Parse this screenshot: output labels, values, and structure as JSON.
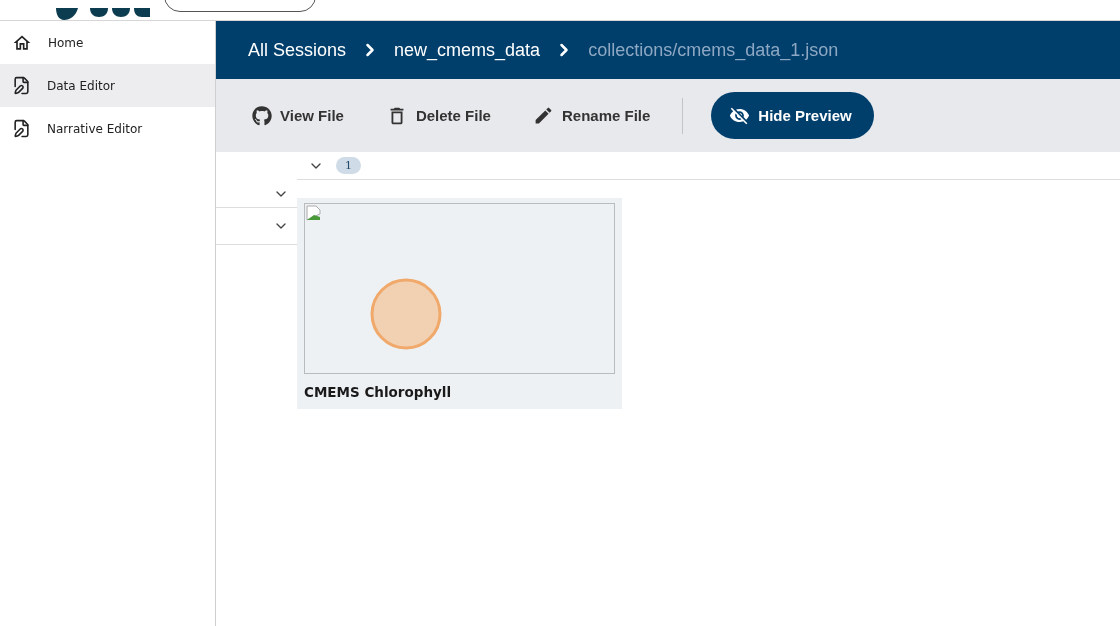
{
  "sidebar": {
    "items": [
      {
        "label": "Home",
        "kind": "home",
        "selected": false
      },
      {
        "label": "Data Editor",
        "kind": "editor",
        "selected": true
      },
      {
        "label": "Narrative Editor",
        "kind": "editor",
        "selected": false
      }
    ]
  },
  "breadcrumbs": [
    {
      "label": "All Sessions",
      "current": false
    },
    {
      "label": "new_cmems_data",
      "current": false
    },
    {
      "label": "collections/cmems_data_1.json",
      "current": true
    }
  ],
  "toolbar": {
    "buttons": [
      {
        "label": "View File",
        "kind": "github"
      },
      {
        "label": "Delete File",
        "kind": "delete"
      },
      {
        "label": "Rename File",
        "kind": "rename"
      },
      {
        "label": "Hide Preview",
        "kind": "hide-preview"
      }
    ]
  },
  "tree": {
    "badge": "1"
  },
  "cards": [
    {
      "title": "CMEMS Chlorophyll"
    }
  ]
}
